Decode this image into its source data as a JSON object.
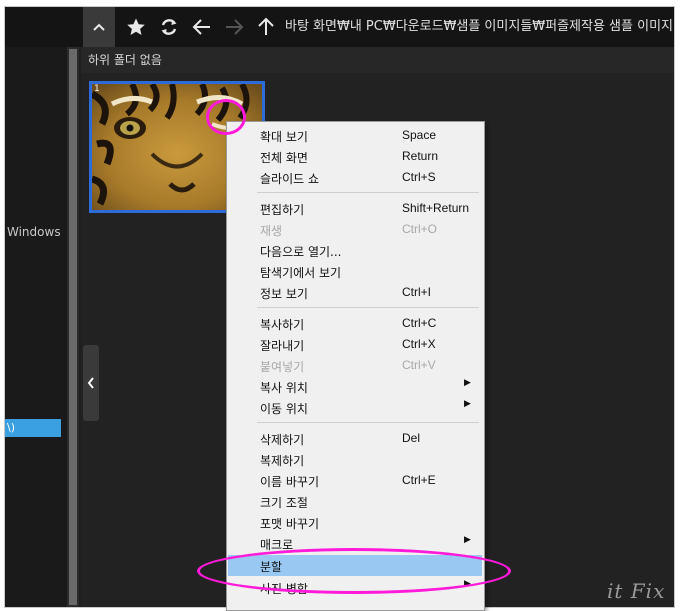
{
  "toolbar": {
    "path": "바탕 화면₩내 PC₩다운로드₩샘플 이미지들₩퍼즐제작용 샘플 이미지"
  },
  "sidebar": {
    "windows_label": "Windows",
    "selected_label": "\\)"
  },
  "subbar": {
    "text": "하위 폴더 없음"
  },
  "thumbnail": {
    "index": "1"
  },
  "context_menu": {
    "items": [
      {
        "label": "확대 보기",
        "shortcut": "Space"
      },
      {
        "label": "전체 화면",
        "shortcut": "Return"
      },
      {
        "label": "슬라이드 쇼",
        "shortcut": "Ctrl+S"
      },
      {
        "label": "편집하기",
        "shortcut": "Shift+Return"
      },
      {
        "label": "재생",
        "shortcut": "Ctrl+O"
      },
      {
        "label": "다음으로 열기...",
        "shortcut": ""
      },
      {
        "label": "탐색기에서 보기",
        "shortcut": ""
      },
      {
        "label": "정보 보기",
        "shortcut": "Ctrl+I"
      },
      {
        "label": "복사하기",
        "shortcut": "Ctrl+C"
      },
      {
        "label": "잘라내기",
        "shortcut": "Ctrl+X"
      },
      {
        "label": "붙여넣기",
        "shortcut": "Ctrl+V"
      },
      {
        "label": "복사 위치",
        "shortcut": ""
      },
      {
        "label": "이동 위치",
        "shortcut": ""
      },
      {
        "label": "삭제하기",
        "shortcut": "Del"
      },
      {
        "label": "복제하기",
        "shortcut": ""
      },
      {
        "label": "이름 바꾸기",
        "shortcut": "Ctrl+E"
      },
      {
        "label": "크기 조절",
        "shortcut": ""
      },
      {
        "label": "포맷 바꾸기",
        "shortcut": ""
      },
      {
        "label": "매크로",
        "shortcut": ""
      },
      {
        "label": "분할",
        "shortcut": ""
      },
      {
        "label": "사진 병합",
        "shortcut": ""
      }
    ]
  },
  "watermark": "it Fix",
  "colors": {
    "highlight": "#99c9f3",
    "annotation": "#ff1ad9",
    "selection": "#2c6bd8"
  },
  "icons": [
    "chevron-up-icon",
    "star-icon",
    "refresh-icon",
    "arrow-left-icon",
    "arrow-right-icon",
    "arrow-up-icon",
    "chevron-left-icon",
    "submenu-arrow-icon"
  ]
}
